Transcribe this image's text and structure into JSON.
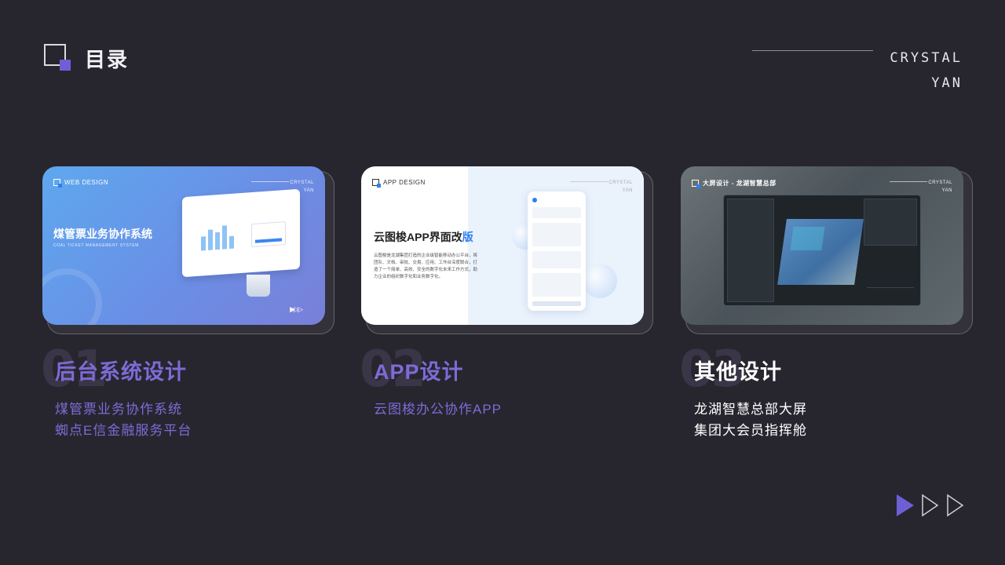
{
  "header": {
    "title": "目录",
    "brand_line1": "CRYSTAL",
    "brand_line2": "YAN"
  },
  "colors": {
    "background": "#27262f",
    "accent": "#6f5fd6",
    "section_purple": "#7e6bd6",
    "app_blue": "#2f7ff0"
  },
  "cards": [
    {
      "tag": "WEB DESIGN",
      "corner_line1": "CRYSTAL",
      "corner_line2": "YAN",
      "headline": "煤管票业务协作系统",
      "subline": "COAL TICKET MANAGEMENT SYSTEM",
      "number": "01",
      "title": "后台系统设计",
      "items": [
        "煤管票业务协作系统",
        "蜘点E信金融服务平台"
      ]
    },
    {
      "tag": "APP DESIGN",
      "corner_line1": "CRYSTAL",
      "corner_line2": "YAN",
      "headline_main": "云图梭APP界面改",
      "headline_highlight": "版",
      "paragraph": "云图梭是龙湖集团打造的企业级智能移动办公平台，将团队、文档、审批、交易、应用、工作台深度联合，打造了一个简单、高效、安全的数字化未来工作方式，助力企业的组织数字化和业务数字化。",
      "number": "02",
      "title": "APP设计",
      "items": [
        "云图梭办公协作APP"
      ]
    },
    {
      "tag": "大屏设计 - 龙湖智慧总部",
      "corner_line1": "CRYSTAL",
      "corner_line2": "YAN",
      "number": "03",
      "title": "其他设计",
      "items": [
        "龙湖智慧总部大屏",
        "集团大会员指挥舱"
      ]
    }
  ],
  "icons": {
    "logo": "square-logo-icon",
    "nav_active": "play-filled-icon",
    "nav_next": "play-outline-icon"
  }
}
